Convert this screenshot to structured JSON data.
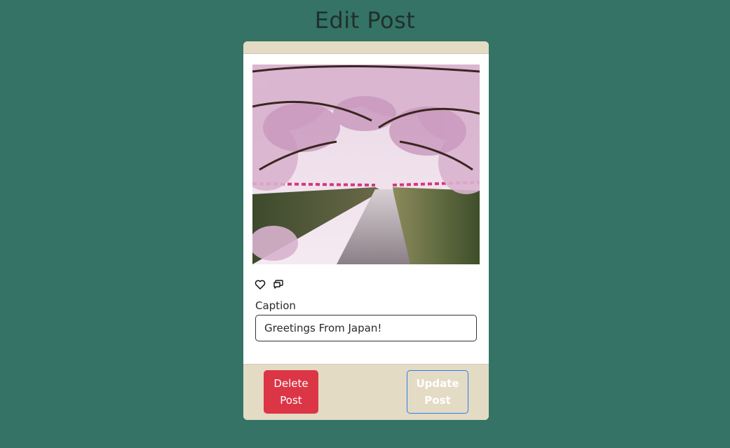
{
  "page": {
    "title": "Edit Post"
  },
  "post": {
    "image_alt": "Cherry blossom trees over a canal",
    "like_icon": "heart-icon",
    "comment_icon": "comment-icon",
    "caption_label": "Caption",
    "caption_value": "Greetings From Japan!"
  },
  "actions": {
    "delete_label": "Delete Post",
    "update_label": "Update Post"
  },
  "colors": {
    "background": "#347365",
    "card_header": "#e3dbc4",
    "delete_button": "#dc3545",
    "update_border": "#2f7bf5"
  }
}
